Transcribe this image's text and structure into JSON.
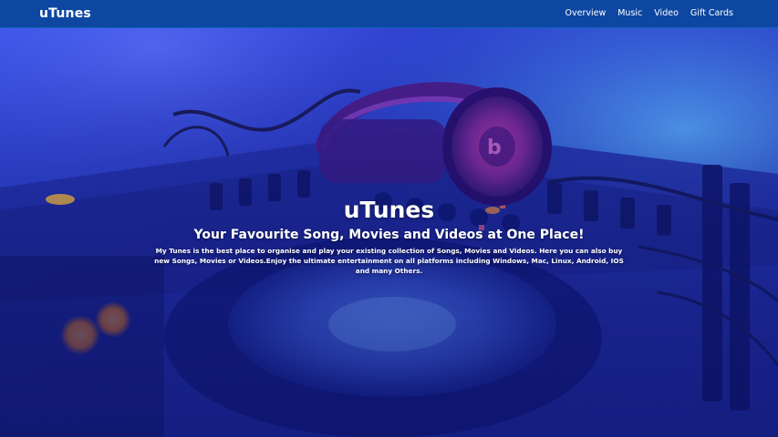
{
  "navbar": {
    "brand": "uTunes",
    "links": [
      "Overview",
      "Music",
      "Video",
      "Gift Cards"
    ]
  },
  "hero": {
    "title": "uTunes",
    "subtitle": "Your Favourite Song, Movies and Videos at One Place!",
    "description": "My Tunes is the best place to organise and play your existing collection of Songs, Movies and Videos. Here you can also buy new Songs, Movies or Videos.Enjoy the ultimate entertainment on all platforms including Windows, Mac, Linux, Android, IOS and many Others."
  },
  "colors": {
    "navbar": "#0d47a1",
    "hero_tint": "#2b3fd6",
    "accent_orange": "#ff8c2a"
  }
}
